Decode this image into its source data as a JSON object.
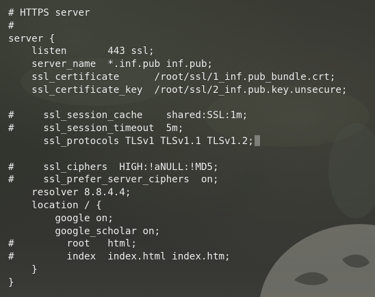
{
  "terminal": {
    "lines": [
      "# HTTPS server",
      "#",
      "server {",
      "    listen       443 ssl;",
      "    server_name  *.inf.pub inf.pub;",
      "    ssl_certificate      /root/ssl/1_inf.pub_bundle.crt;",
      "    ssl_certificate_key  /root/ssl/2_inf.pub.key.unsecure;",
      "",
      "#     ssl_session_cache    shared:SSL:1m;",
      "#     ssl_session_timeout  5m;",
      "      ssl_protocols TLSv1 TLSv1.1 TLSv1.2;",
      "",
      "#     ssl_ciphers  HIGH:!aNULL:!MD5;",
      "#     ssl_prefer_server_ciphers  on;",
      "    resolver 8.8.4.4;",
      "    location / {",
      "        google on;",
      "        google_scholar on;",
      "#         root   html;",
      "#         index  index.html index.htm;",
      "    }",
      "}"
    ],
    "cursor_line_index": 10
  },
  "colors": {
    "text": "#f2f2f2",
    "background": "#2d2e2a"
  }
}
